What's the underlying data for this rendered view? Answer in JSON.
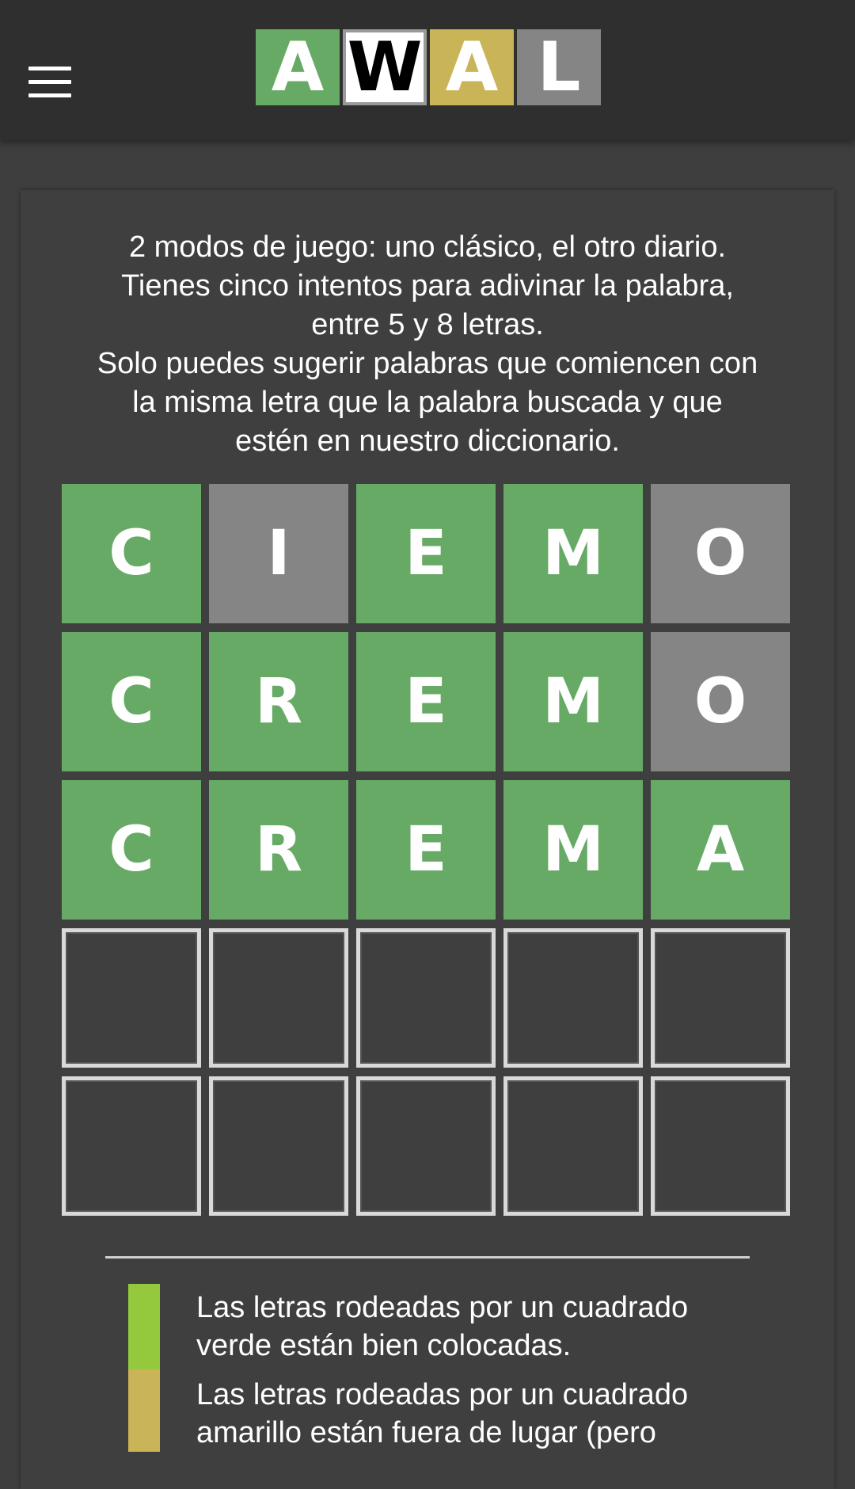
{
  "header": {
    "menu_icon": "hamburger-menu-icon",
    "logo": [
      {
        "letter": "A",
        "bg": "#67aa66",
        "fg": "#ffffff"
      },
      {
        "letter": "W",
        "bg": "#ffffff",
        "fg": "#000000"
      },
      {
        "letter": "A",
        "bg": "#c9b458",
        "fg": "#ffffff"
      },
      {
        "letter": "L",
        "bg": "#858585",
        "fg": "#ffffff"
      }
    ]
  },
  "intro": {
    "lines": [
      "2 modos de juego: uno clásico, el otro diario.",
      "Tienes cinco intentos para adivinar la palabra,",
      "entre 5 y 8 letras.",
      "Solo puedes sugerir palabras que comiencen con",
      "la misma letra que la palabra buscada y que",
      "estén en nuestro diccionario."
    ]
  },
  "board": {
    "rows": [
      [
        {
          "letter": "C",
          "state": "correct"
        },
        {
          "letter": "I",
          "state": "absent"
        },
        {
          "letter": "E",
          "state": "correct"
        },
        {
          "letter": "M",
          "state": "correct"
        },
        {
          "letter": "O",
          "state": "absent"
        }
      ],
      [
        {
          "letter": "C",
          "state": "correct"
        },
        {
          "letter": "R",
          "state": "correct"
        },
        {
          "letter": "E",
          "state": "correct"
        },
        {
          "letter": "M",
          "state": "correct"
        },
        {
          "letter": "O",
          "state": "absent"
        }
      ],
      [
        {
          "letter": "C",
          "state": "correct"
        },
        {
          "letter": "R",
          "state": "correct"
        },
        {
          "letter": "E",
          "state": "correct"
        },
        {
          "letter": "M",
          "state": "correct"
        },
        {
          "letter": "A",
          "state": "correct"
        }
      ],
      [
        {
          "letter": "",
          "state": "empty"
        },
        {
          "letter": "",
          "state": "empty"
        },
        {
          "letter": "",
          "state": "empty"
        },
        {
          "letter": "",
          "state": "empty"
        },
        {
          "letter": "",
          "state": "empty"
        }
      ],
      [
        {
          "letter": "",
          "state": "empty"
        },
        {
          "letter": "",
          "state": "empty"
        },
        {
          "letter": "",
          "state": "empty"
        },
        {
          "letter": "",
          "state": "empty"
        },
        {
          "letter": "",
          "state": "empty"
        }
      ]
    ]
  },
  "legend": {
    "green": {
      "color": "#95c93d",
      "lines": [
        "Las letras rodeadas por un cuadrado",
        "verde están bien colocadas."
      ]
    },
    "yellow": {
      "color": "#c9b458",
      "lines": [
        "Las letras rodeadas por un cuadrado",
        "amarillo están fuera de lugar (pero"
      ]
    }
  }
}
